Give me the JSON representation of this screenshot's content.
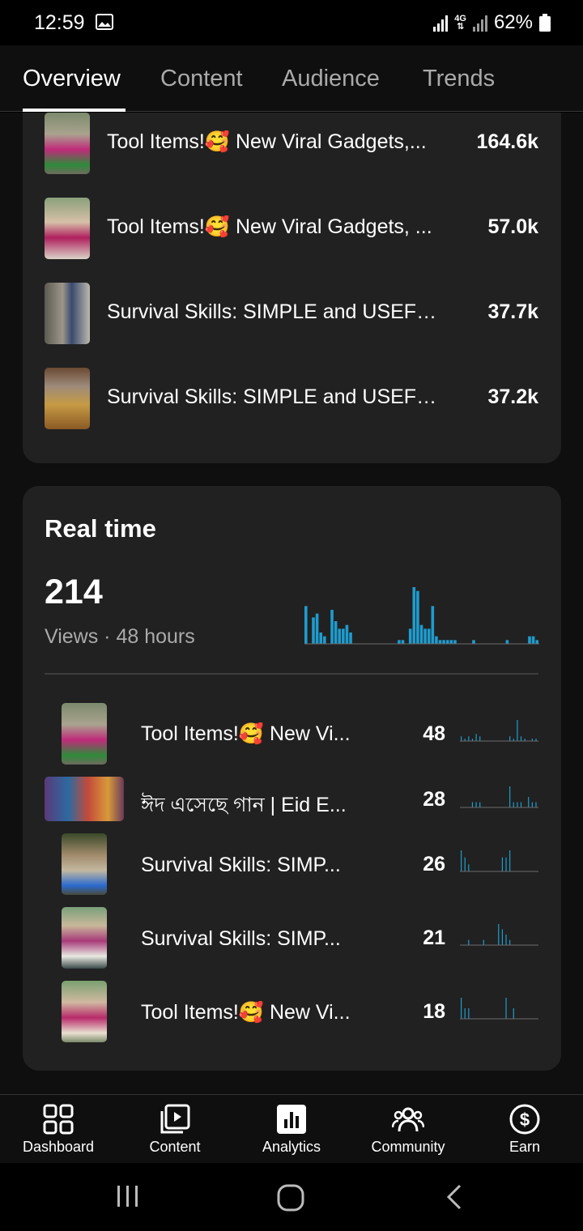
{
  "status_bar": {
    "time": "12:59",
    "network": "4G",
    "battery": "62%",
    "icons": [
      "image-icon",
      "signal-icon",
      "battery-icon"
    ]
  },
  "tabs": [
    {
      "label": "Overview",
      "active": true
    },
    {
      "label": "Content",
      "active": false
    },
    {
      "label": "Audience",
      "active": false
    },
    {
      "label": "Trends",
      "active": false
    }
  ],
  "top_content": {
    "items": [
      {
        "title": "Tool Items!🥰 New Viral Gadgets,...",
        "views": "164.6k"
      },
      {
        "title": "Tool Items!🥰 New Viral Gadgets, ...",
        "views": "57.0k"
      },
      {
        "title": "Survival Skills: SIMPLE and USEFU...",
        "views": "37.7k"
      },
      {
        "title": "Survival Skills: SIMPLE and USEFU...",
        "views": "37.2k"
      }
    ]
  },
  "realtime": {
    "title": "Real time",
    "count": "214",
    "subtitle": "Views · 48 hours",
    "chart_bars": [
      0,
      0,
      0,
      0,
      0,
      0,
      0,
      0,
      0,
      0,
      0,
      0,
      0,
      0,
      0,
      0,
      0,
      0,
      0,
      0,
      0,
      0,
      0,
      0,
      0,
      0,
      0,
      0,
      0,
      0,
      0,
      0,
      0,
      0,
      0,
      0,
      0,
      0,
      0,
      0,
      0,
      0,
      0,
      0,
      0,
      0,
      0,
      0,
      0,
      0,
      0,
      0,
      0,
      0,
      0,
      0,
      0,
      0,
      0,
      0,
      0,
      0,
      0,
      0,
      0,
      0,
      0,
      0,
      0,
      0,
      0,
      0,
      0,
      0,
      0,
      0,
      0,
      0,
      0,
      0,
      0,
      0,
      0,
      0,
      0,
      0,
      0,
      0,
      0,
      0,
      0,
      0,
      0,
      0,
      0,
      0,
      0,
      0,
      0,
      0,
      0,
      0,
      0,
      0,
      0,
      0,
      0,
      0,
      0,
      0,
      0,
      0,
      0,
      0,
      0,
      0,
      0,
      0,
      0,
      0,
      0,
      0,
      0,
      0,
      0,
      0,
      0,
      0,
      0,
      0,
      0,
      0,
      0,
      0,
      0,
      0,
      0,
      0,
      0,
      0,
      0,
      0,
      0,
      0,
      0,
      0,
      0,
      0
    ],
    "bars": [
      10,
      0,
      7,
      8,
      3,
      2,
      0,
      9,
      6,
      4,
      4,
      5,
      3,
      0,
      0,
      0,
      0,
      0,
      0,
      0,
      0,
      0,
      0,
      0,
      0,
      1,
      1,
      0,
      4,
      15,
      14,
      5,
      4,
      4,
      10,
      2,
      1,
      1,
      1,
      1,
      1,
      0,
      0,
      0,
      0,
      1,
      0,
      0,
      0,
      0,
      0,
      0,
      0,
      0,
      1,
      0,
      0,
      0,
      0,
      0,
      2,
      2,
      1
    ],
    "videos": [
      {
        "title": "Tool Items!🥰 New Vi...",
        "views": "48",
        "spark": [
          2,
          1,
          2,
          1,
          3,
          2,
          0,
          0,
          0,
          0,
          0,
          0,
          0,
          2,
          1,
          9,
          2,
          1,
          0,
          1,
          1
        ]
      },
      {
        "title": "ঈদ এসেছে গান | Eid E...",
        "views": "28",
        "spark": [
          0,
          0,
          0,
          1,
          1,
          1,
          0,
          0,
          0,
          0,
          0,
          0,
          0,
          4,
          1,
          1,
          1,
          0,
          2,
          1,
          1
        ]
      },
      {
        "title": "Survival Skills: SIMP...",
        "views": "26",
        "spark": [
          3,
          2,
          1,
          0,
          0,
          0,
          0,
          0,
          0,
          0,
          0,
          2,
          2,
          3,
          0,
          0,
          0,
          0,
          0,
          0,
          0
        ]
      },
      {
        "title": "Survival Skills: SIMP...",
        "views": "21",
        "spark": [
          0,
          0,
          1,
          0,
          0,
          0,
          1,
          0,
          0,
          0,
          4,
          3,
          2,
          1,
          0,
          0,
          0,
          0,
          0,
          0,
          0
        ]
      },
      {
        "title": "Tool Items!🥰 New Vi...",
        "views": "18",
        "spark": [
          2,
          1,
          1,
          0,
          0,
          0,
          0,
          0,
          0,
          0,
          0,
          0,
          2,
          0,
          1,
          0,
          0,
          0,
          0,
          0,
          0
        ]
      }
    ]
  },
  "bottom_nav": [
    {
      "label": "Dashboard",
      "icon": "dashboard-icon"
    },
    {
      "label": "Content",
      "icon": "content-icon"
    },
    {
      "label": "Analytics",
      "icon": "analytics-icon",
      "active": true
    },
    {
      "label": "Community",
      "icon": "community-icon"
    },
    {
      "label": "Earn",
      "icon": "earn-icon"
    }
  ],
  "colors": {
    "accent": "#1e9ccf",
    "card": "#212121",
    "background": "#0f0f0f"
  }
}
